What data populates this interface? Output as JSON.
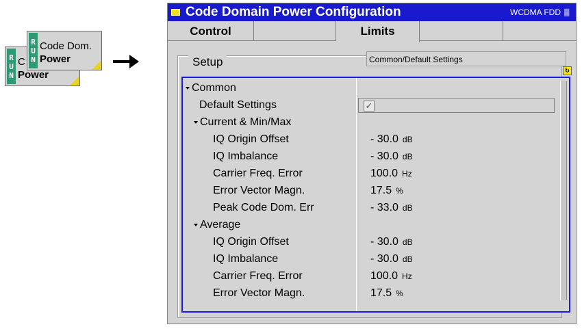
{
  "softkey_back": {
    "run": "RUN",
    "line1": "C",
    "line2": "Power"
  },
  "softkey_front": {
    "run": "RUN",
    "line1": "Code Dom.",
    "line2": "Power"
  },
  "window": {
    "title": "Code Domain Power Configuration",
    "system": "WCDMA FDD",
    "system_icon": "wcdma-mode-icon"
  },
  "tabs": [
    {
      "label": "Control"
    },
    {
      "label": ""
    },
    {
      "label": "Limits",
      "active": true
    },
    {
      "label": ""
    },
    {
      "label": ""
    }
  ],
  "setup": {
    "label": "Setup",
    "info": "Common/Default Settings"
  },
  "tree": {
    "common": {
      "label": "Common"
    },
    "default_settings": {
      "label": "Default Settings",
      "checked": true,
      "check_glyph": "✓"
    },
    "current": {
      "label": "Current & Min/Max",
      "items": [
        {
          "label": "IQ Origin Offset",
          "value": "- 30.0",
          "unit": "dB"
        },
        {
          "label": "IQ Imbalance",
          "value": "- 30.0",
          "unit": "dB"
        },
        {
          "label": "Carrier Freq. Error",
          "value": "100.0",
          "unit": "Hz"
        },
        {
          "label": "Error Vector Magn.",
          "value": "17.5",
          "unit": "%"
        },
        {
          "label": "Peak Code Dom. Err",
          "value": "- 33.0",
          "unit": "dB"
        }
      ]
    },
    "average": {
      "label": "Average",
      "items": [
        {
          "label": "IQ Origin Offset",
          "value": "- 30.0",
          "unit": "dB"
        },
        {
          "label": "IQ Imbalance",
          "value": "- 30.0",
          "unit": "dB"
        },
        {
          "label": "Carrier Freq. Error",
          "value": "100.0",
          "unit": "Hz"
        },
        {
          "label": "Error Vector Magn.",
          "value": "17.5",
          "unit": "%"
        }
      ]
    }
  },
  "colors": {
    "titlebar": "#1919ce",
    "run": "#2e9a74",
    "accent": "#f3e21a",
    "focus": "#1a1ae0"
  }
}
